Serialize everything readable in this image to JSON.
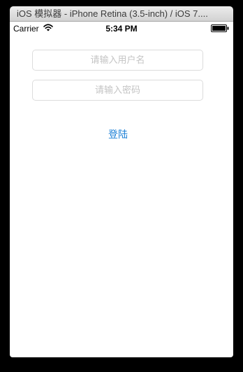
{
  "window": {
    "title": "iOS 模拟器 - iPhone Retina (3.5-inch) / iOS 7...."
  },
  "statusbar": {
    "carrier": "Carrier",
    "time": "5:34 PM",
    "wifi_icon": "wifi-icon",
    "battery_icon": "battery-icon"
  },
  "form": {
    "username_placeholder": "请输入用户名",
    "username_value": "",
    "password_placeholder": "请输入密码",
    "password_value": "",
    "login_label": "登陆"
  },
  "colors": {
    "accent": "#1a7fd6",
    "placeholder": "#c4c4c4",
    "field_border": "#dcdcdc"
  }
}
